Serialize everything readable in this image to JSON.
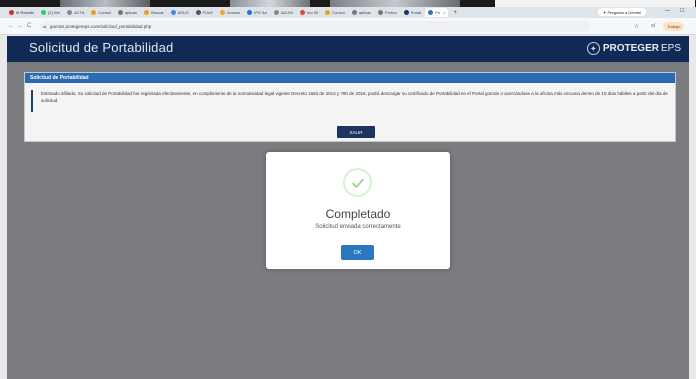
{
  "browser": {
    "tabs": [
      {
        "label": "M Restabl",
        "color": "#d93025"
      },
      {
        "label": "(2) Wh",
        "color": "#25d366"
      },
      {
        "label": "ACTA",
        "color": "#888888"
      },
      {
        "label": "Consul",
        "color": "#e8a317"
      },
      {
        "label": "aplicac",
        "color": "#777777"
      },
      {
        "label": "Buscar",
        "color": "#e8a317"
      },
      {
        "label": "ASUS",
        "color": "#4285f4"
      },
      {
        "label": "FUAF",
        "color": "#555555"
      },
      {
        "label": "Acceso",
        "color": "#f5a623"
      },
      {
        "label": "IPS Sa",
        "color": "#1a73e8"
      },
      {
        "label": "ADUSI",
        "color": "#888888"
      },
      {
        "label": "nro 90",
        "color": "#ea4335"
      },
      {
        "label": "Consul",
        "color": "#e8a317"
      },
      {
        "label": "aplicac",
        "color": "#777777"
      },
      {
        "label": "Protec",
        "color": "#777777"
      },
      {
        "label": "Portal",
        "color": "#1d3461"
      }
    ],
    "active_tab": {
      "label": "Po",
      "color": "#2b78c2",
      "close": "×"
    },
    "new_tab": "+",
    "gemini": "✦ Pregunta a Gemini",
    "win_min": "—",
    "win_restore": "☐",
    "nav": {
      "back": "←",
      "forward": "→",
      "reload": "C"
    },
    "url": "gomsis.protegereps.com/solicitud_portabilidad.php",
    "url_icon": "⇆",
    "star": "☆",
    "ext": "≡/",
    "profile": "Trabajo"
  },
  "header": {
    "title": "Solicitud de Portabilidad",
    "logo_mark": "✦",
    "logo_main": "PROTEGER",
    "logo_suffix": "EPS"
  },
  "panel": {
    "heading": "Solicitud de Portabilidad",
    "message": "Estimado afiliado, Su solicitud de Portabilidad fue registrada efectivamente, en cumplimiento de la normatividad legal vigente Decreto 1683 de 2013 y 780 de 2016, podrá descargar su certificado de Portabilidad en el Portal gomsis o acercándose a la oficina más cercana dentro de 10 días hábiles a partir del día de solicitud.",
    "exit_label": "SALIR"
  },
  "modal": {
    "icon": "check-circle-icon",
    "title": "Completado",
    "text": "Solicitud enviada correctamente",
    "ok_label": "OK",
    "icon_color": "#8fd07a"
  }
}
